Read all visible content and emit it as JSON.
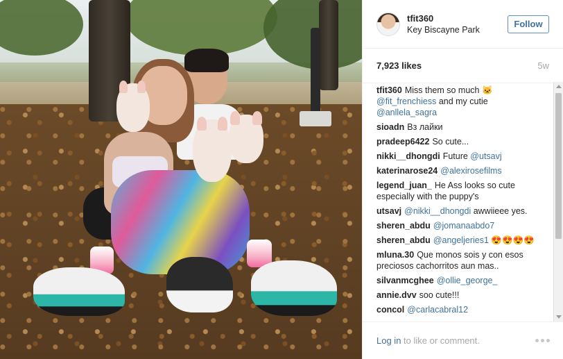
{
  "header": {
    "username": "tfit360",
    "location": "Key Biscayne Park",
    "follow_label": "Follow"
  },
  "stats": {
    "likes": "7,923 likes",
    "age": "5w"
  },
  "comments": [
    {
      "user": "tfit360",
      "parts": [
        {
          "t": "text",
          "v": "Miss them so much 🐱 "
        },
        {
          "t": "mention",
          "v": "@fit_frenchiess"
        },
        {
          "t": "text",
          "v": " and my cutie "
        },
        {
          "t": "mention",
          "v": "@anllela_sagra"
        }
      ]
    },
    {
      "user": "sioadn",
      "parts": [
        {
          "t": "text",
          "v": "Вз лайки"
        }
      ]
    },
    {
      "user": "pradeep6422",
      "parts": [
        {
          "t": "text",
          "v": "So cute..."
        }
      ]
    },
    {
      "user": "nikki__dhongdi",
      "parts": [
        {
          "t": "text",
          "v": "Future "
        },
        {
          "t": "mention",
          "v": "@utsavj"
        }
      ]
    },
    {
      "user": "katerinarose24",
      "parts": [
        {
          "t": "mention",
          "v": "@alexirosefilms"
        }
      ]
    },
    {
      "user": "legend_juan_",
      "parts": [
        {
          "t": "text",
          "v": "He Ass looks so cute especially with the puppy's"
        }
      ]
    },
    {
      "user": "utsavj",
      "parts": [
        {
          "t": "mention",
          "v": "@nikki__dhongdi"
        },
        {
          "t": "text",
          "v": " awwiieee yes."
        }
      ]
    },
    {
      "user": "sheren_abdu",
      "parts": [
        {
          "t": "mention",
          "v": "@jomanaabdo7"
        }
      ]
    },
    {
      "user": "sheren_abdu",
      "parts": [
        {
          "t": "mention",
          "v": "@angeljeries1"
        },
        {
          "t": "text",
          "v": " 😍😍😍😍"
        }
      ]
    },
    {
      "user": "mluna.30",
      "parts": [
        {
          "t": "text",
          "v": "Que monos sois y con esos preciosos cachorritos aun mas.."
        }
      ]
    },
    {
      "user": "silvanmcghee",
      "parts": [
        {
          "t": "mention",
          "v": "@ollie_george_"
        }
      ]
    },
    {
      "user": "annie.dvv",
      "parts": [
        {
          "t": "text",
          "v": "soo cute!!!"
        }
      ]
    },
    {
      "user": "concol",
      "parts": [
        {
          "t": "mention",
          "v": "@carlacabral12"
        }
      ]
    }
  ],
  "footer": {
    "login_link": "Log in",
    "login_rest": " to like or comment."
  },
  "icons": {
    "more": "more-options-icon",
    "avatar": "profile-avatar"
  },
  "colors": {
    "link": "#3f729b",
    "follow_border": "#5a8fcb",
    "muted": "#a5a7aa"
  }
}
